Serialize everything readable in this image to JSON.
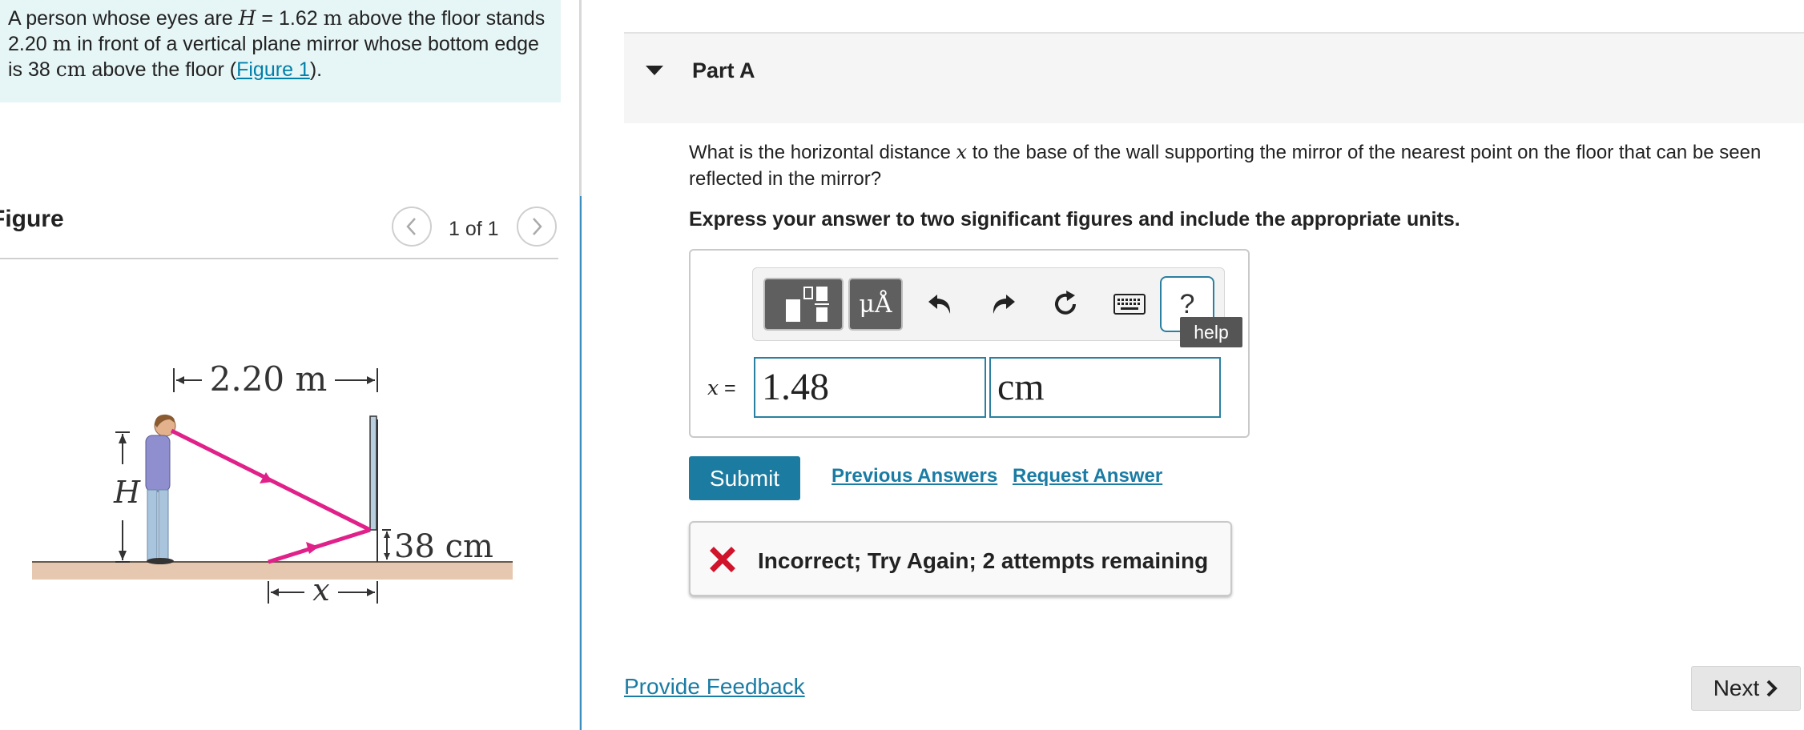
{
  "problem": {
    "intro": {
      "t1": "A person whose eyes are ",
      "h_var": "H",
      "t2": " = 1.62 ",
      "m_unit": "m",
      "t3": " above the floor stands 2.20 ",
      "m_unit2": "m",
      "t4": " in front of a vertical plane mirror whose bottom edge is 38 ",
      "cm_unit": "cm",
      "t5": " above the floor (",
      "figure_link": "Figure 1",
      "t6": ")."
    }
  },
  "figure_panel": {
    "title": "Figure",
    "pager_text": "1 of 1",
    "prev_icon": "chevron-left-icon",
    "next_icon": "chevron-right-icon",
    "labels": {
      "distance": "2.20 m",
      "height": "H",
      "mirror_height": "38 cm",
      "x": "x"
    },
    "colors": {
      "ray": "#e0218a",
      "floor": "#e6c8b0",
      "shirt": "#8f8fd0",
      "pants": "#a9c4dd"
    }
  },
  "part": {
    "title": "Part A",
    "question_before": "What is the horizontal distance ",
    "question_var": "x",
    "question_after": " to the base of the wall supporting the mirror of the nearest point on the floor that can be seen reflected in the mirror?",
    "instruction": "Express your answer to two significant figures and include the appropriate units."
  },
  "toolbar": {
    "units_label": "μÅ",
    "help_label": "?",
    "help_tooltip": "help",
    "icons": [
      "templates-icon",
      "units-icon",
      "undo-icon",
      "redo-icon",
      "reset-icon",
      "keyboard-icon",
      "help-icon"
    ]
  },
  "answer": {
    "var": "x",
    "eq": " =",
    "value": "1.48",
    "units": "cm"
  },
  "actions": {
    "submit": "Submit",
    "previous_answers": "Previous Answers",
    "request_answer": "Request Answer"
  },
  "feedback": {
    "message": "Incorrect; Try Again; 2 attempts remaining",
    "status_color": "#d0142c"
  },
  "footer": {
    "provide_feedback": "Provide Feedback",
    "next": "Next"
  }
}
